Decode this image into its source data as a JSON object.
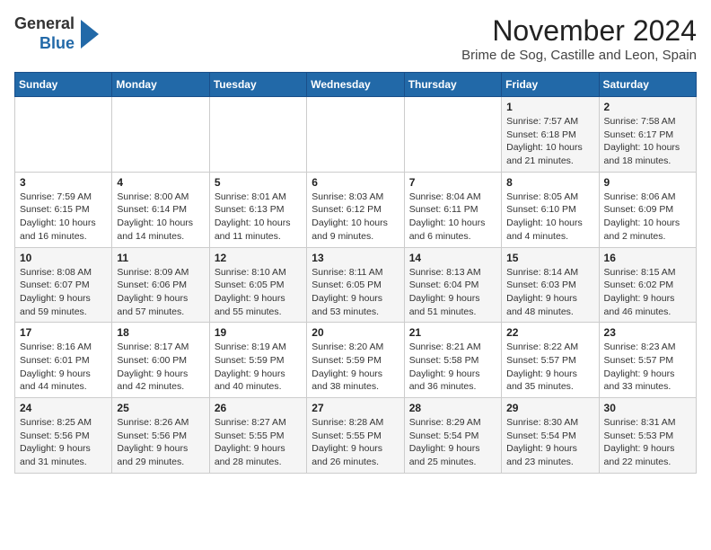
{
  "header": {
    "logo_line1": "General",
    "logo_line2": "Blue",
    "title": "November 2024",
    "subtitle": "Brime de Sog, Castille and Leon, Spain"
  },
  "weekdays": [
    "Sunday",
    "Monday",
    "Tuesday",
    "Wednesday",
    "Thursday",
    "Friday",
    "Saturday"
  ],
  "weeks": [
    [
      {
        "day": "",
        "info": ""
      },
      {
        "day": "",
        "info": ""
      },
      {
        "day": "",
        "info": ""
      },
      {
        "day": "",
        "info": ""
      },
      {
        "day": "",
        "info": ""
      },
      {
        "day": "1",
        "info": "Sunrise: 7:57 AM\nSunset: 6:18 PM\nDaylight: 10 hours\nand 21 minutes."
      },
      {
        "day": "2",
        "info": "Sunrise: 7:58 AM\nSunset: 6:17 PM\nDaylight: 10 hours\nand 18 minutes."
      }
    ],
    [
      {
        "day": "3",
        "info": "Sunrise: 7:59 AM\nSunset: 6:15 PM\nDaylight: 10 hours\nand 16 minutes."
      },
      {
        "day": "4",
        "info": "Sunrise: 8:00 AM\nSunset: 6:14 PM\nDaylight: 10 hours\nand 14 minutes."
      },
      {
        "day": "5",
        "info": "Sunrise: 8:01 AM\nSunset: 6:13 PM\nDaylight: 10 hours\nand 11 minutes."
      },
      {
        "day": "6",
        "info": "Sunrise: 8:03 AM\nSunset: 6:12 PM\nDaylight: 10 hours\nand 9 minutes."
      },
      {
        "day": "7",
        "info": "Sunrise: 8:04 AM\nSunset: 6:11 PM\nDaylight: 10 hours\nand 6 minutes."
      },
      {
        "day": "8",
        "info": "Sunrise: 8:05 AM\nSunset: 6:10 PM\nDaylight: 10 hours\nand 4 minutes."
      },
      {
        "day": "9",
        "info": "Sunrise: 8:06 AM\nSunset: 6:09 PM\nDaylight: 10 hours\nand 2 minutes."
      }
    ],
    [
      {
        "day": "10",
        "info": "Sunrise: 8:08 AM\nSunset: 6:07 PM\nDaylight: 9 hours\nand 59 minutes."
      },
      {
        "day": "11",
        "info": "Sunrise: 8:09 AM\nSunset: 6:06 PM\nDaylight: 9 hours\nand 57 minutes."
      },
      {
        "day": "12",
        "info": "Sunrise: 8:10 AM\nSunset: 6:05 PM\nDaylight: 9 hours\nand 55 minutes."
      },
      {
        "day": "13",
        "info": "Sunrise: 8:11 AM\nSunset: 6:05 PM\nDaylight: 9 hours\nand 53 minutes."
      },
      {
        "day": "14",
        "info": "Sunrise: 8:13 AM\nSunset: 6:04 PM\nDaylight: 9 hours\nand 51 minutes."
      },
      {
        "day": "15",
        "info": "Sunrise: 8:14 AM\nSunset: 6:03 PM\nDaylight: 9 hours\nand 48 minutes."
      },
      {
        "day": "16",
        "info": "Sunrise: 8:15 AM\nSunset: 6:02 PM\nDaylight: 9 hours\nand 46 minutes."
      }
    ],
    [
      {
        "day": "17",
        "info": "Sunrise: 8:16 AM\nSunset: 6:01 PM\nDaylight: 9 hours\nand 44 minutes."
      },
      {
        "day": "18",
        "info": "Sunrise: 8:17 AM\nSunset: 6:00 PM\nDaylight: 9 hours\nand 42 minutes."
      },
      {
        "day": "19",
        "info": "Sunrise: 8:19 AM\nSunset: 5:59 PM\nDaylight: 9 hours\nand 40 minutes."
      },
      {
        "day": "20",
        "info": "Sunrise: 8:20 AM\nSunset: 5:59 PM\nDaylight: 9 hours\nand 38 minutes."
      },
      {
        "day": "21",
        "info": "Sunrise: 8:21 AM\nSunset: 5:58 PM\nDaylight: 9 hours\nand 36 minutes."
      },
      {
        "day": "22",
        "info": "Sunrise: 8:22 AM\nSunset: 5:57 PM\nDaylight: 9 hours\nand 35 minutes."
      },
      {
        "day": "23",
        "info": "Sunrise: 8:23 AM\nSunset: 5:57 PM\nDaylight: 9 hours\nand 33 minutes."
      }
    ],
    [
      {
        "day": "24",
        "info": "Sunrise: 8:25 AM\nSunset: 5:56 PM\nDaylight: 9 hours\nand 31 minutes."
      },
      {
        "day": "25",
        "info": "Sunrise: 8:26 AM\nSunset: 5:56 PM\nDaylight: 9 hours\nand 29 minutes."
      },
      {
        "day": "26",
        "info": "Sunrise: 8:27 AM\nSunset: 5:55 PM\nDaylight: 9 hours\nand 28 minutes."
      },
      {
        "day": "27",
        "info": "Sunrise: 8:28 AM\nSunset: 5:55 PM\nDaylight: 9 hours\nand 26 minutes."
      },
      {
        "day": "28",
        "info": "Sunrise: 8:29 AM\nSunset: 5:54 PM\nDaylight: 9 hours\nand 25 minutes."
      },
      {
        "day": "29",
        "info": "Sunrise: 8:30 AM\nSunset: 5:54 PM\nDaylight: 9 hours\nand 23 minutes."
      },
      {
        "day": "30",
        "info": "Sunrise: 8:31 AM\nSunset: 5:53 PM\nDaylight: 9 hours\nand 22 minutes."
      }
    ]
  ]
}
